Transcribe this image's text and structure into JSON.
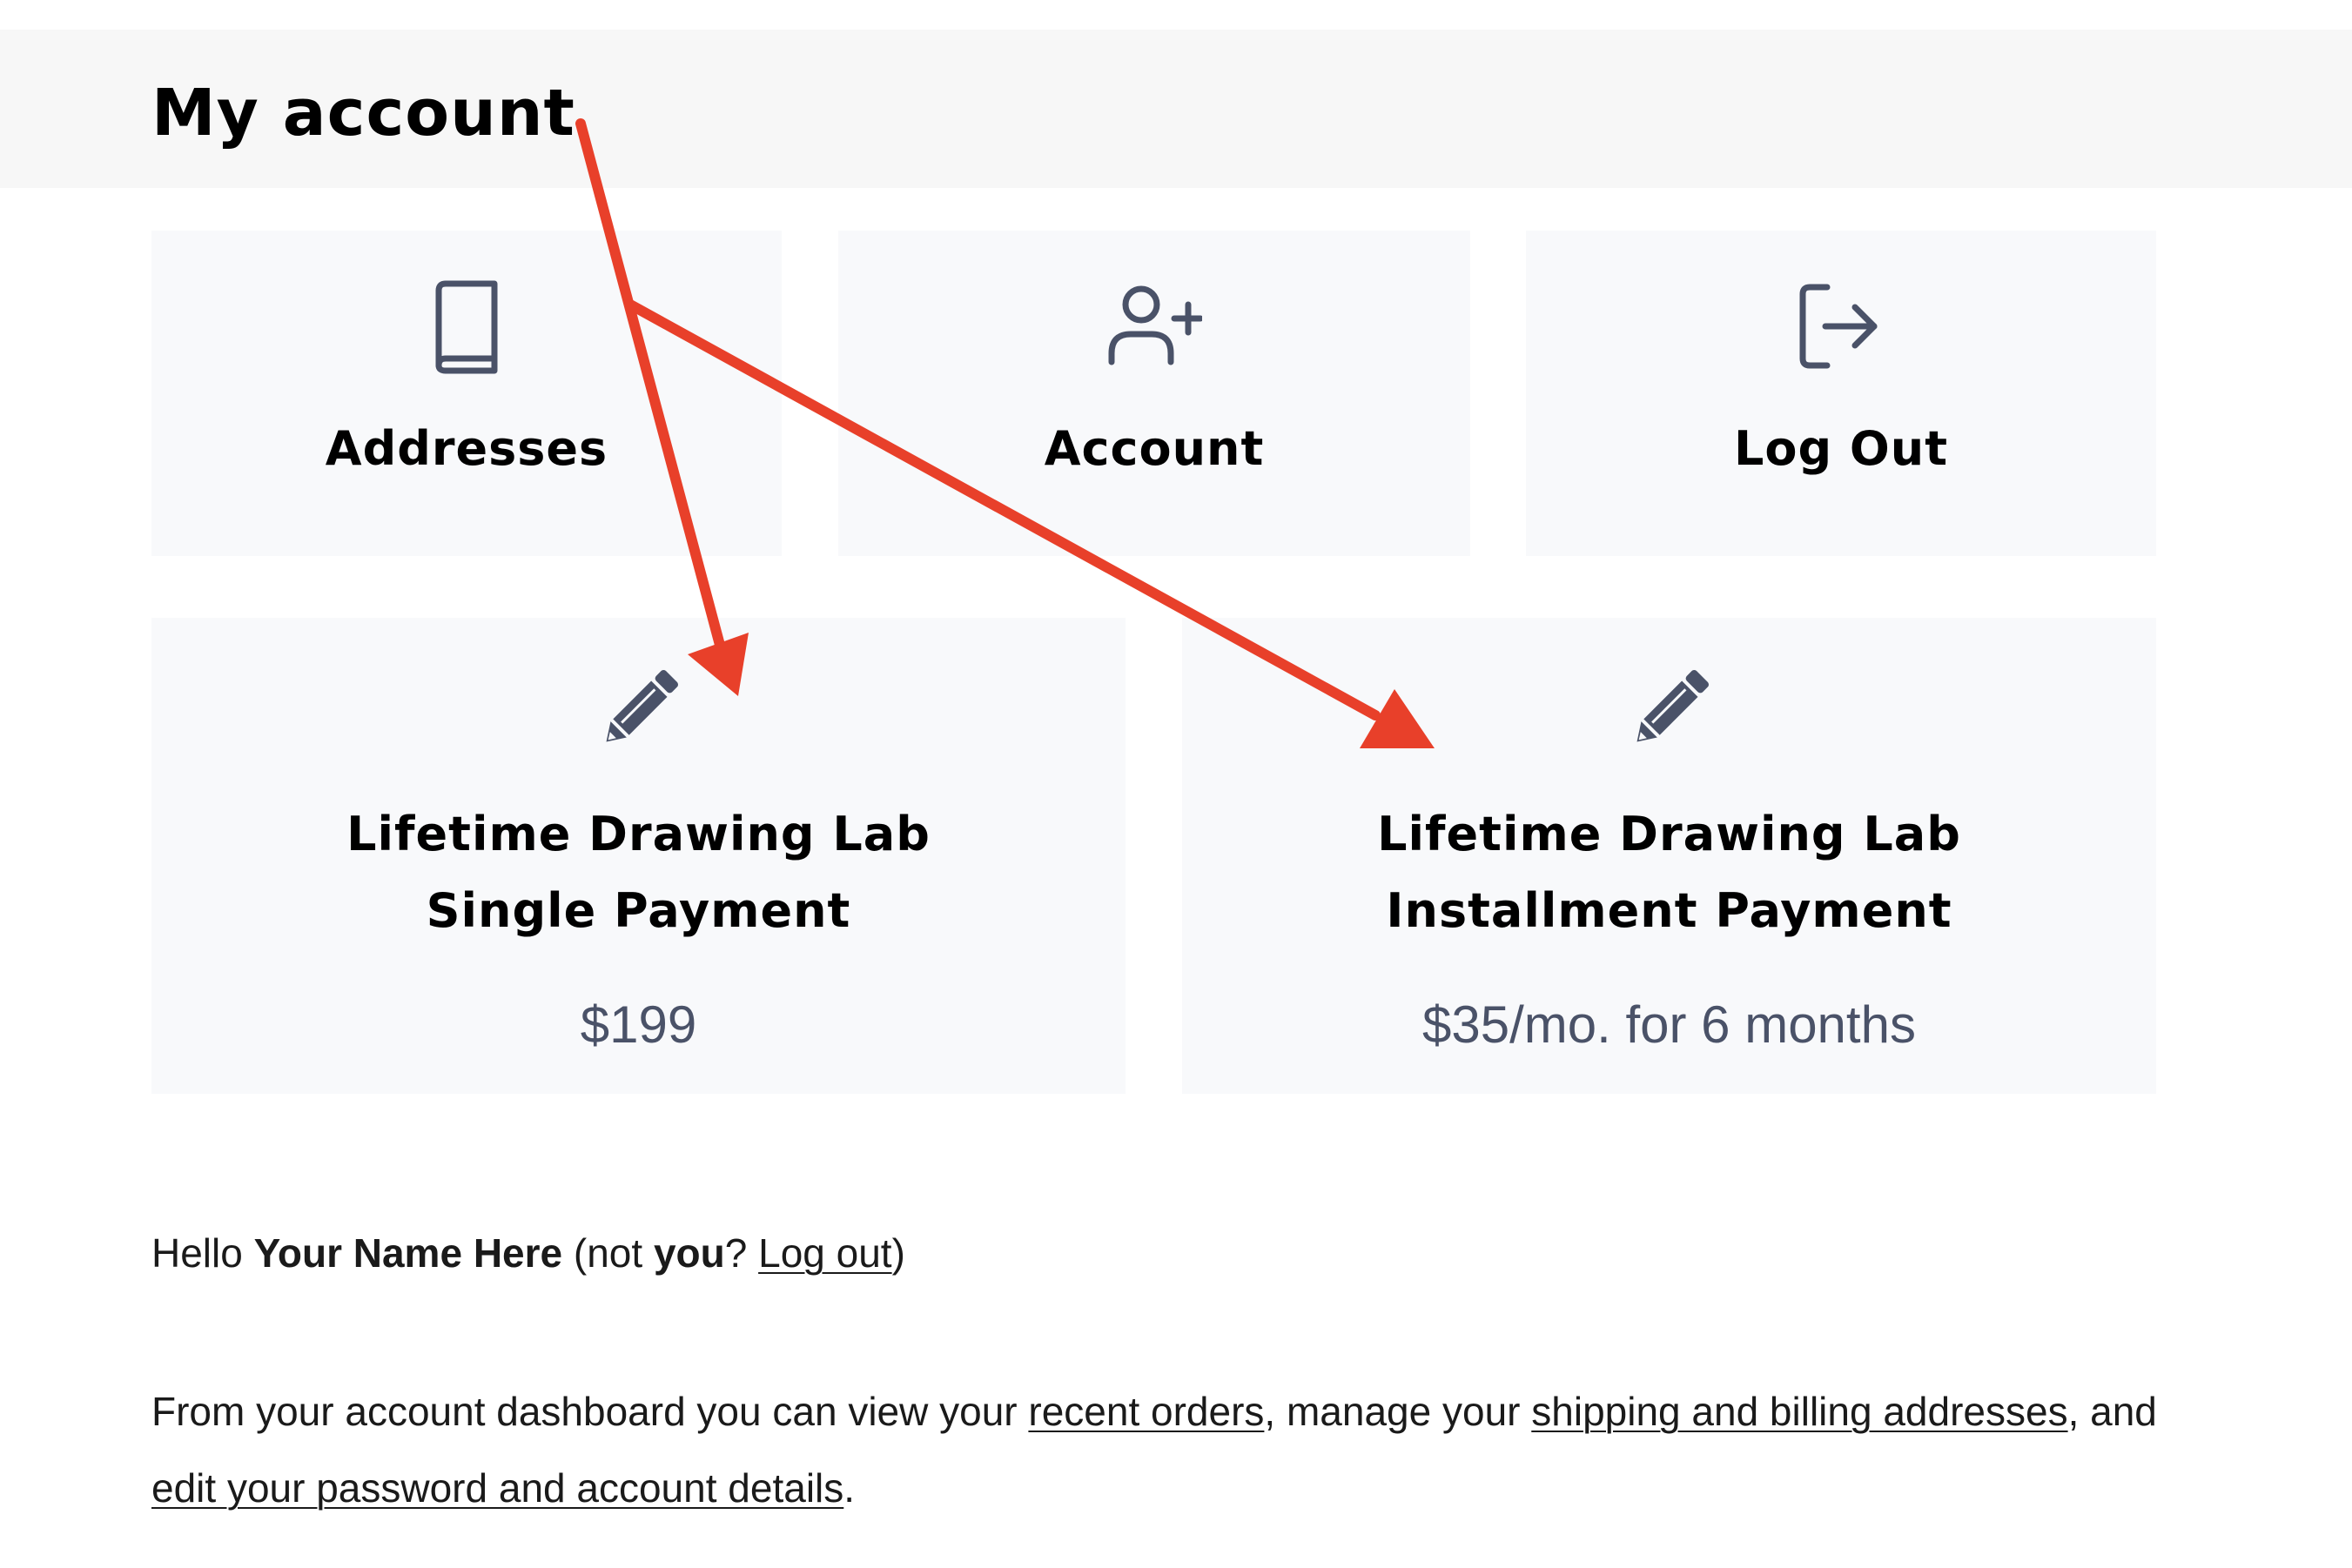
{
  "page": {
    "title": "My account"
  },
  "nav_tiles": [
    {
      "label": "Addresses",
      "icon": "book-icon"
    },
    {
      "label": "Account",
      "icon": "user-plus-icon"
    },
    {
      "label": "Log Out",
      "icon": "logout-icon"
    }
  ],
  "product_tiles": [
    {
      "name_line1": "Lifetime Drawing Lab",
      "name_line2": "Single Payment",
      "price": "$199",
      "icon": "pencil-icon"
    },
    {
      "name_line1": "Lifetime Drawing Lab",
      "name_line2": "Installment Payment",
      "price": "$35/mo. for 6 months",
      "icon": "pencil-icon"
    }
  ],
  "greeting": {
    "hello": "Hello",
    "name": "Your Name Here",
    "not_prefix": "(not",
    "you": "you",
    "question": "?",
    "logout_link": "Log out",
    "close_paren": ")"
  },
  "intro": {
    "part1": "From your account dashboard you can view your",
    "recent_orders_link": "recent orders",
    "part2": ", manage your",
    "addresses_link": "shipping and billing addresses",
    "part3": ", and",
    "account_details_link": "edit your password and account details",
    "part4": "."
  },
  "colors": {
    "annotation_arrow": "#e8402a",
    "icon": "#4a5268",
    "tile_background": "#f8f9fb",
    "header_background": "#f7f7f7"
  }
}
